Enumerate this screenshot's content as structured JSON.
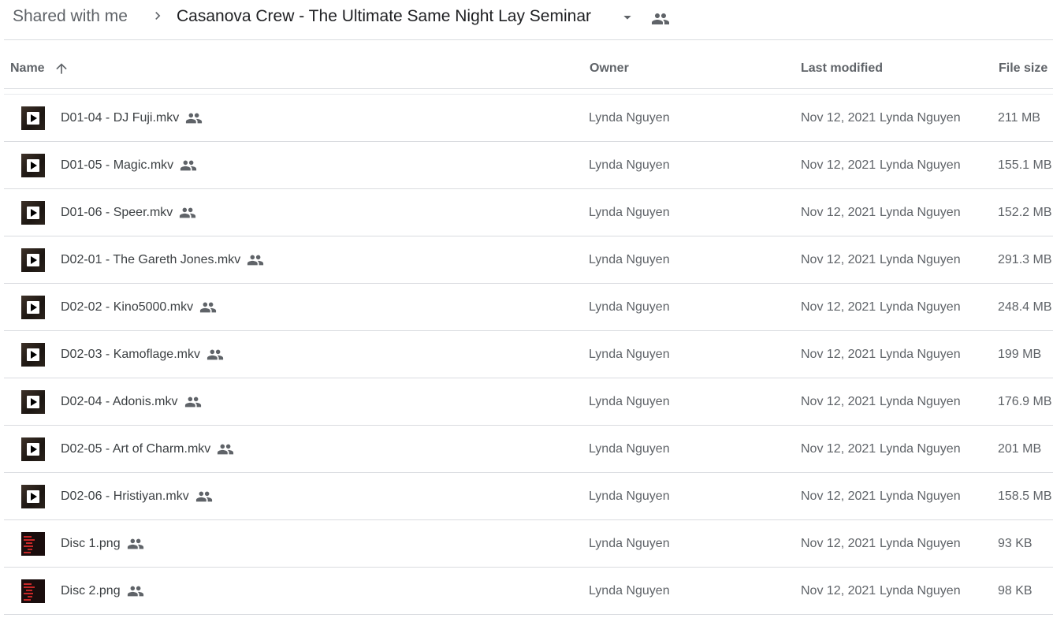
{
  "breadcrumb": {
    "root": "Shared with me",
    "current": "Casanova Crew - The Ultimate Same Night Lay Seminar"
  },
  "columns": {
    "name": "Name",
    "owner": "Owner",
    "last_modified": "Last modified",
    "file_size": "File size"
  },
  "colors": {
    "text_primary": "#3c4043",
    "text_secondary": "#5f6368",
    "divider": "#dadce0",
    "icon_gray": "#5f6368"
  },
  "files": [
    {
      "name": "D01-04 - DJ Fuji.mkv",
      "type": "video",
      "owner": "Lynda Nguyen",
      "modified": "Nov 12, 2021",
      "modified_by": "Lynda Nguyen",
      "size": "211 MB"
    },
    {
      "name": "D01-05 - Magic.mkv",
      "type": "video",
      "owner": "Lynda Nguyen",
      "modified": "Nov 12, 2021",
      "modified_by": "Lynda Nguyen",
      "size": "155.1 MB"
    },
    {
      "name": "D01-06 - Speer.mkv",
      "type": "video",
      "owner": "Lynda Nguyen",
      "modified": "Nov 12, 2021",
      "modified_by": "Lynda Nguyen",
      "size": "152.2 MB"
    },
    {
      "name": "D02-01 - The Gareth Jones.mkv",
      "type": "video",
      "owner": "Lynda Nguyen",
      "modified": "Nov 12, 2021",
      "modified_by": "Lynda Nguyen",
      "size": "291.3 MB"
    },
    {
      "name": "D02-02 - Kino5000.mkv",
      "type": "video",
      "owner": "Lynda Nguyen",
      "modified": "Nov 12, 2021",
      "modified_by": "Lynda Nguyen",
      "size": "248.4 MB"
    },
    {
      "name": "D02-03 - Kamoflage.mkv",
      "type": "video",
      "owner": "Lynda Nguyen",
      "modified": "Nov 12, 2021",
      "modified_by": "Lynda Nguyen",
      "size": "199 MB"
    },
    {
      "name": "D02-04 - Adonis.mkv",
      "type": "video",
      "owner": "Lynda Nguyen",
      "modified": "Nov 12, 2021",
      "modified_by": "Lynda Nguyen",
      "size": "176.9 MB"
    },
    {
      "name": "D02-05 - Art of Charm.mkv",
      "type": "video",
      "owner": "Lynda Nguyen",
      "modified": "Nov 12, 2021",
      "modified_by": "Lynda Nguyen",
      "size": "201 MB"
    },
    {
      "name": "D02-06 - Hristiyan.mkv",
      "type": "video",
      "owner": "Lynda Nguyen",
      "modified": "Nov 12, 2021",
      "modified_by": "Lynda Nguyen",
      "size": "158.5 MB"
    },
    {
      "name": "Disc 1.png",
      "type": "image",
      "owner": "Lynda Nguyen",
      "modified": "Nov 12, 2021",
      "modified_by": "Lynda Nguyen",
      "size": "93 KB"
    },
    {
      "name": "Disc 2.png",
      "type": "image",
      "owner": "Lynda Nguyen",
      "modified": "Nov 12, 2021",
      "modified_by": "Lynda Nguyen",
      "size": "98 KB"
    }
  ]
}
